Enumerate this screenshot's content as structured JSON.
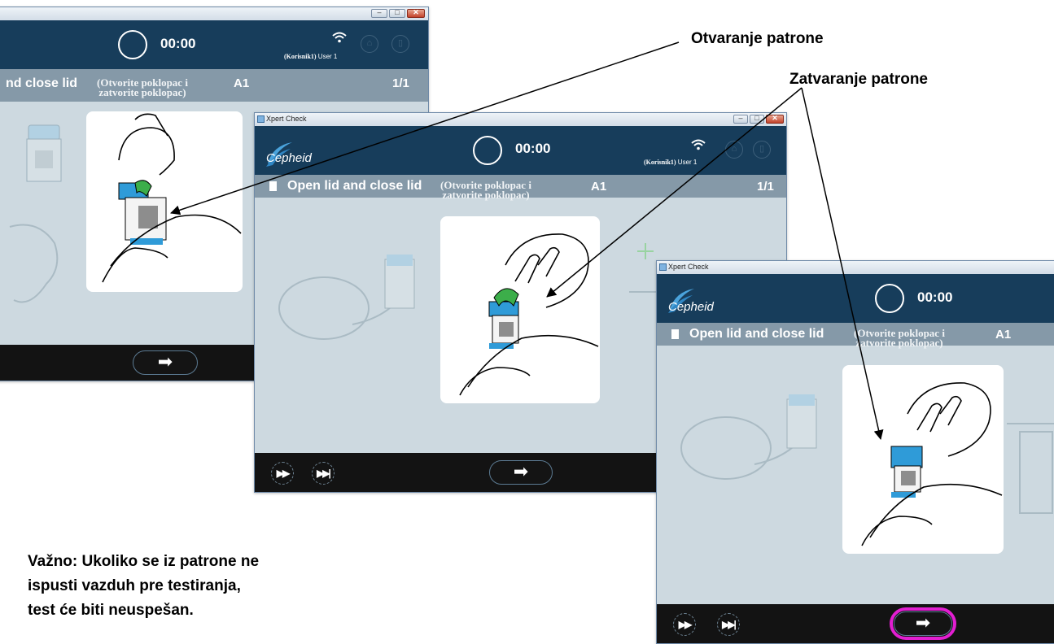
{
  "annotations": {
    "open_cartridge": "Otvaranje patrone",
    "close_cartridge": "Zatvaranje patrone"
  },
  "note": {
    "line1": "Važno: Ukoliko se iz patrone ne",
    "line2": "ispusti vazduh pre testiranja,",
    "line3": "test će biti neuspešan."
  },
  "windows": [
    {
      "title": "",
      "timer": "00:00",
      "user_translation": "(Korisnik1)",
      "user_name": "User 1",
      "step_title": "nd close lid",
      "step_translation_line1": "(Otvorite poklopac i",
      "step_translation_line2": "zatvorite poklopac)",
      "tube_id": "A1",
      "step_counter": "1/1",
      "next_glyph": "➡"
    },
    {
      "title": "Xpert Check",
      "logo": "Cepheid",
      "timer": "00:00",
      "user_translation": "(Korisnik1)",
      "user_name": "User 1",
      "step_title": "Open lid and close lid",
      "step_translation_line1": "(Otvorite poklopac i",
      "step_translation_line2": "zatvorite poklopac)",
      "tube_id": "A1",
      "step_counter": "1/1",
      "next_glyph": "➡",
      "ff_glyph": "▶▶",
      "skip_glyph": "▶▶|"
    },
    {
      "title": "Xpert Check",
      "logo": "Cepheid",
      "timer": "00:00",
      "step_title": "Open lid and close lid",
      "step_translation_line1": "(Otvorite poklopac i",
      "step_translation_line2": "zatvorite poklopac)",
      "tube_id": "A1",
      "next_glyph": "➡",
      "ff_glyph": "▶▶",
      "skip_glyph": "▶▶|"
    }
  ],
  "colors": {
    "header": "#173d5b",
    "step_bar": "#8599a8",
    "content_bg": "#cdd9e0",
    "footer": "#131313",
    "highlight": "#e21ed1",
    "cartridge_blue": "#2f9bd8",
    "lid_green": "#3cae4a"
  }
}
